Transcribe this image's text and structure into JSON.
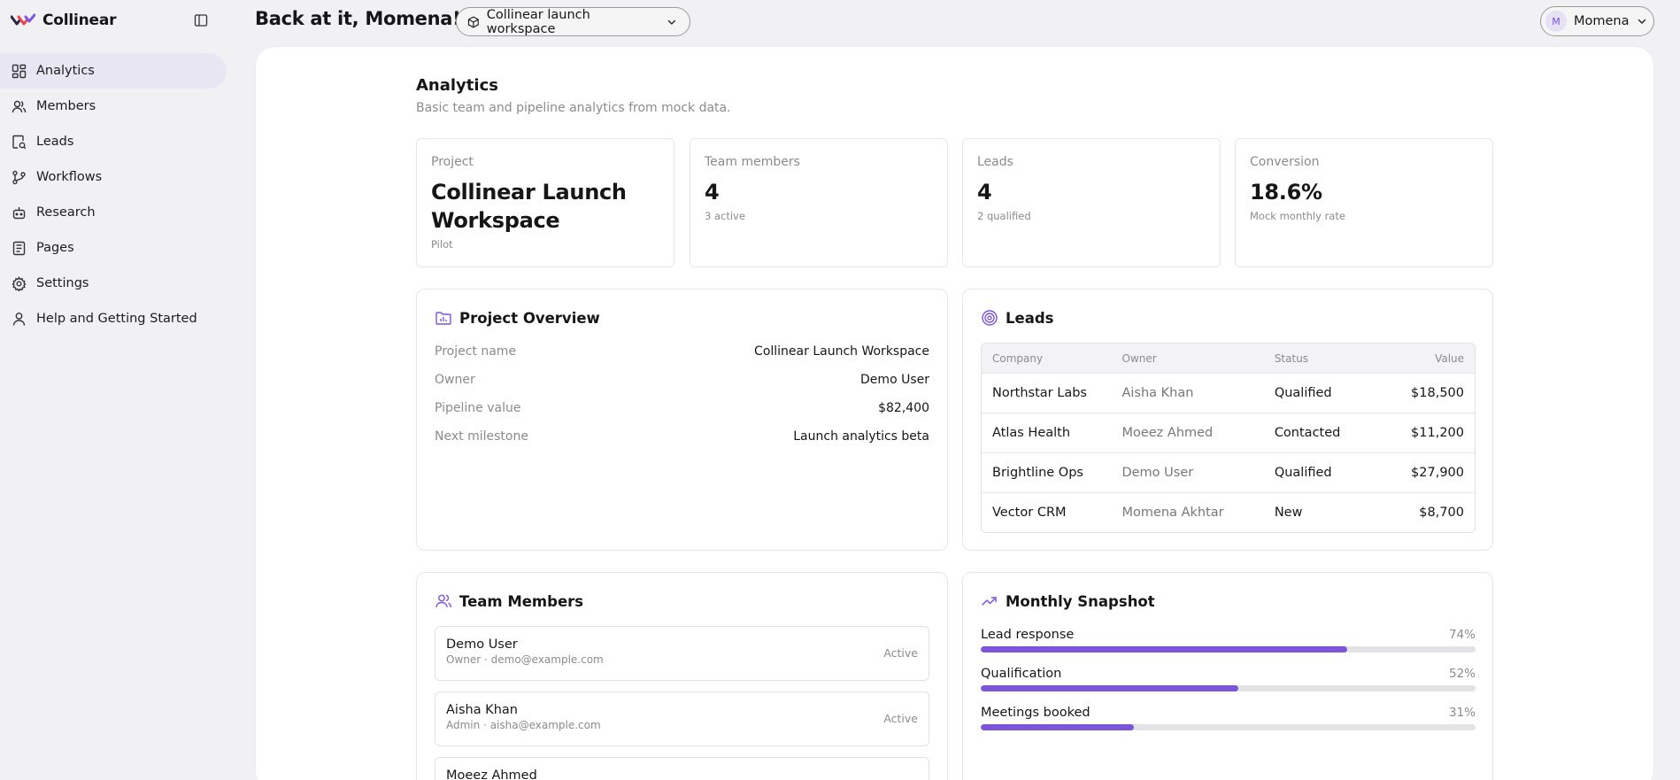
{
  "brand": {
    "name": "Collinear"
  },
  "sidebar": {
    "items": [
      {
        "label": "Analytics",
        "icon": "dashboard-icon",
        "active": true
      },
      {
        "label": "Members",
        "icon": "users-icon"
      },
      {
        "label": "Leads",
        "icon": "search-list-icon"
      },
      {
        "label": "Workflows",
        "icon": "branch-icon"
      },
      {
        "label": "Research",
        "icon": "robot-icon"
      },
      {
        "label": "Pages",
        "icon": "document-icon"
      },
      {
        "label": "Settings",
        "icon": "gear-icon"
      },
      {
        "label": "Help and Getting Started",
        "icon": "person-icon"
      }
    ]
  },
  "header": {
    "greeting": "Back at it, Momena!",
    "workspace": "Collinear launch workspace",
    "user_initial": "M",
    "user_name": "Momena"
  },
  "page": {
    "title": "Analytics",
    "subtitle": "Basic team and pipeline analytics from mock data."
  },
  "stats": [
    {
      "label": "Project",
      "value": "Collinear Launch Workspace",
      "sub": "Pilot"
    },
    {
      "label": "Team members",
      "value": "4",
      "sub": "3 active"
    },
    {
      "label": "Leads",
      "value": "4",
      "sub": "2 qualified"
    },
    {
      "label": "Conversion",
      "value": "18.6%",
      "sub": "Mock monthly rate"
    }
  ],
  "overview": {
    "title": "Project Overview",
    "rows": [
      {
        "key": "Project name",
        "value": "Collinear Launch Workspace"
      },
      {
        "key": "Owner",
        "value": "Demo User"
      },
      {
        "key": "Pipeline value",
        "value": "$82,400"
      },
      {
        "key": "Next milestone",
        "value": "Launch analytics beta"
      }
    ]
  },
  "leads": {
    "title": "Leads",
    "columns": [
      "Company",
      "Owner",
      "Status",
      "Value"
    ],
    "rows": [
      {
        "company": "Northstar Labs",
        "owner": "Aisha Khan",
        "status": "Qualified",
        "value": "$18,500"
      },
      {
        "company": "Atlas Health",
        "owner": "Moeez Ahmed",
        "status": "Contacted",
        "value": "$11,200"
      },
      {
        "company": "Brightline Ops",
        "owner": "Demo User",
        "status": "Qualified",
        "value": "$27,900"
      },
      {
        "company": "Vector CRM",
        "owner": "Momena Akhtar",
        "status": "New",
        "value": "$8,700"
      }
    ]
  },
  "team": {
    "title": "Team Members",
    "members": [
      {
        "name": "Demo User",
        "meta": "Owner · demo@example.com",
        "status": "Active"
      },
      {
        "name": "Aisha Khan",
        "meta": "Admin · aisha@example.com",
        "status": "Active"
      },
      {
        "name": "Moeez Ahmed",
        "meta": "",
        "status": ""
      }
    ]
  },
  "snapshot": {
    "title": "Monthly Snapshot",
    "metrics": [
      {
        "label": "Lead response",
        "pct_label": "74%",
        "value": 74
      },
      {
        "label": "Qualification",
        "pct_label": "52%",
        "value": 52
      },
      {
        "label": "Meetings booked",
        "pct_label": "31%",
        "value": 31
      }
    ]
  },
  "colors": {
    "accent": "#7c55d8",
    "active_nav": "#e9e6f4"
  }
}
